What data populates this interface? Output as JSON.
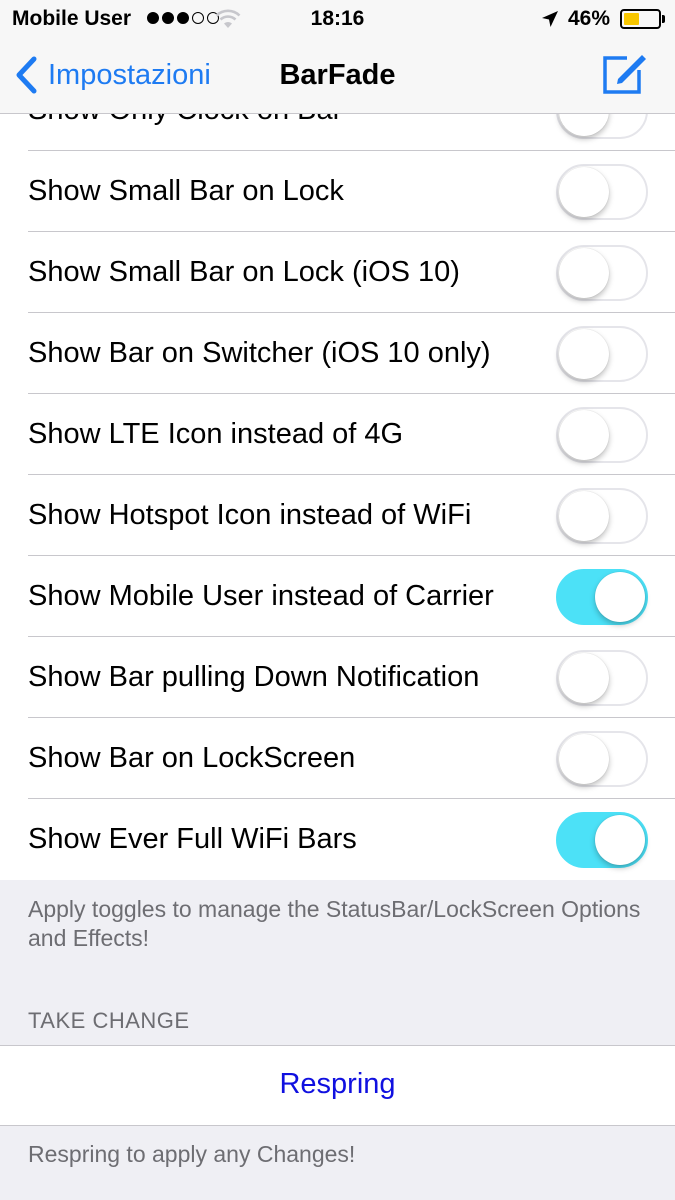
{
  "status_bar": {
    "carrier": "Mobile User",
    "signal_filled": 3,
    "signal_total": 5,
    "time": "18:16",
    "battery_percent": "46%",
    "battery_level": 0.46,
    "battery_color": "#f7c600",
    "icons": [
      "wifi-icon",
      "location-arrow-icon",
      "battery-icon"
    ]
  },
  "nav": {
    "back_label": "Impostazioni",
    "title": "BarFade",
    "accent_color": "#1e7bf2",
    "right_icon": "compose-icon"
  },
  "toggles": [
    {
      "label": "Show Only Clock on Bar",
      "on": false
    },
    {
      "label": "Show Small Bar on Lock",
      "on": false
    },
    {
      "label": "Show Small Bar on Lock (iOS 10)",
      "on": false
    },
    {
      "label": "Show Bar on Switcher (iOS 10 only)",
      "on": false
    },
    {
      "label": "Show LTE Icon instead of 4G",
      "on": false
    },
    {
      "label": "Show Hotspot Icon instead of WiFi",
      "on": false
    },
    {
      "label": "Show Mobile User instead of Carrier",
      "on": true
    },
    {
      "label": "Show Bar pulling Down Notification",
      "on": false
    },
    {
      "label": "Show Bar on LockScreen",
      "on": false
    },
    {
      "label": "Show Ever Full WiFi Bars",
      "on": true
    }
  ],
  "toggle_on_color": "#4ce1f7",
  "toggles_footer": "Apply toggles to manage the StatusBar/LockScreen Options and Effects!",
  "take_change": {
    "header": "TAKE CHANGE",
    "button_label": "Respring",
    "footer": "Respring to apply any Changes!"
  }
}
